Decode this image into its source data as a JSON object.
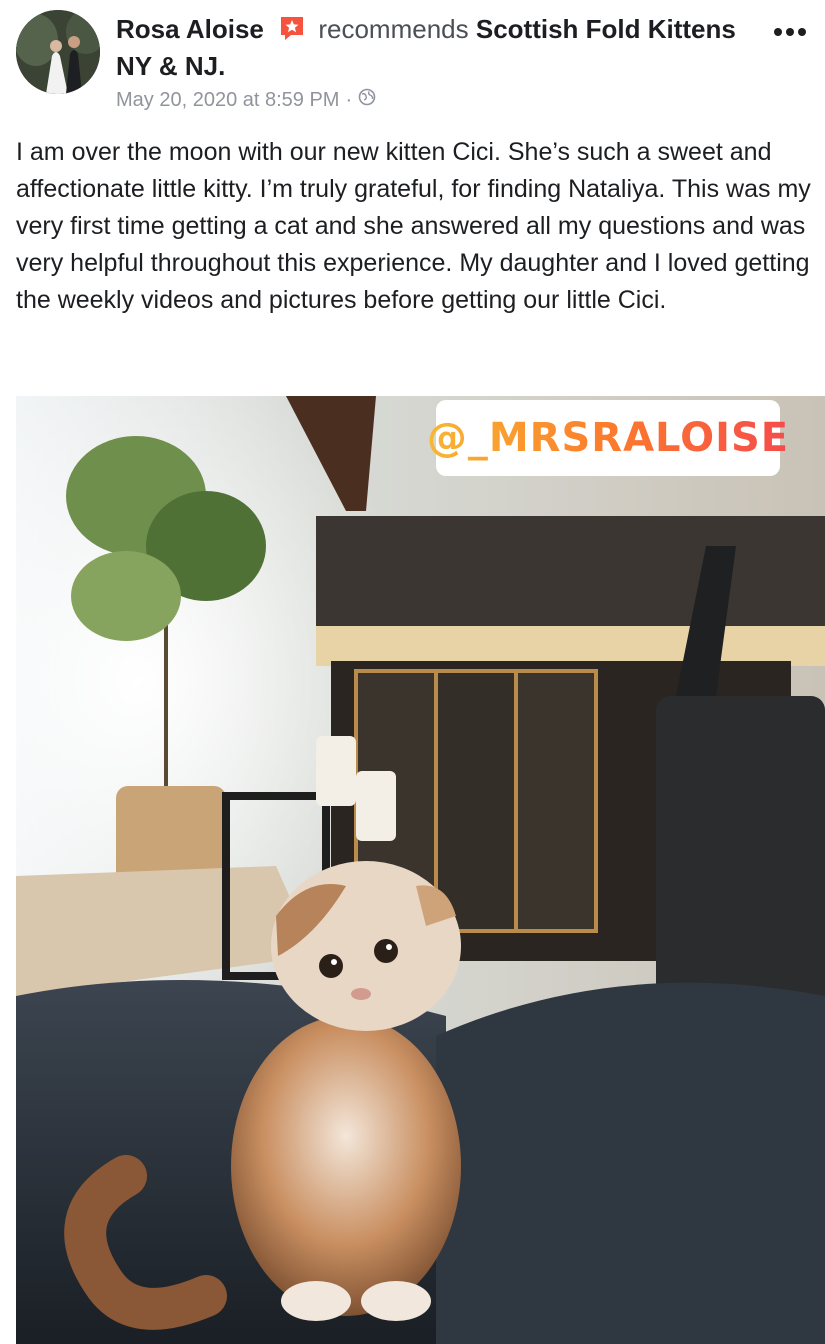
{
  "post": {
    "author": "Rosa Aloise",
    "action": "recommends",
    "page_name": "Scottish Fold Kittens NY & NJ.",
    "timestamp": "May 20, 2020 at 8:59 PM",
    "separator": "·",
    "privacy_icon": "globe-icon",
    "recommend_icon": "star-flag-icon",
    "more_icon": "more-options-icon",
    "text": "I am over the moon with our new kitten Cici. She’s such a sweet and affectionate little kitty. I’m truly grateful, for finding Nataliya. This was my very first time getting a cat and she answered all my questions and was very helpful throughout this experience. My daughter and I loved getting the weekly videos and pictures before getting our little Cici.",
    "photo_tag": "@_MRSRALOISE"
  },
  "colors": {
    "recommend_icon": "#f5533d",
    "text": "#1c1e21",
    "muted": "#90949c"
  }
}
